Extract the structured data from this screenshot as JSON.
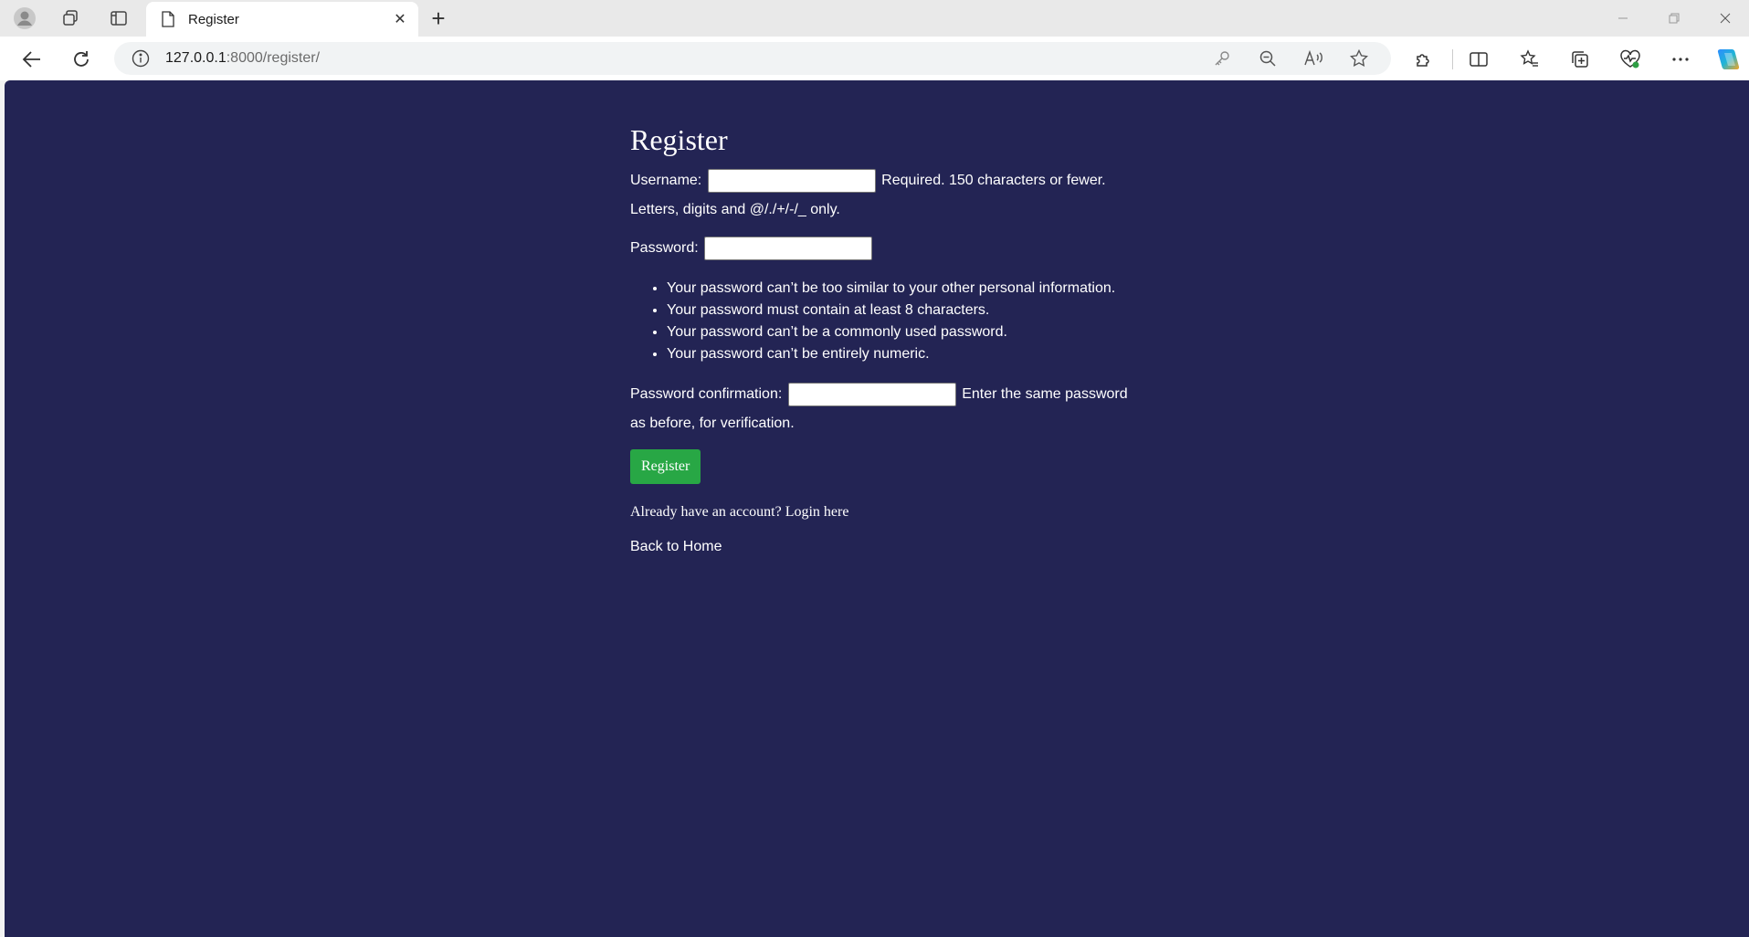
{
  "browser": {
    "tab": {
      "title": "Register",
      "close_glyph": "✕"
    },
    "new_tab_glyph": "+",
    "address": {
      "host": "127.0.0.1",
      "rest": ":8000/register/"
    },
    "icons": {
      "profile": "profile-icon",
      "workspaces": "workspaces-icon",
      "tab_actions": "tab-actions-icon",
      "back": "back-icon",
      "refresh": "refresh-icon",
      "info": "info-icon",
      "key": "key-icon",
      "zoom": "zoom-out-icon",
      "read_aloud": "read-aloud-icon",
      "favorite": "star-icon",
      "extensions": "extensions-icon",
      "split": "split-screen-icon",
      "favorites": "favorites-icon",
      "collections": "collections-icon",
      "health": "browser-essentials-icon",
      "more": "more-icon",
      "copilot": "copilot-icon"
    }
  },
  "page": {
    "title": "Register",
    "username": {
      "label": "Username:",
      "help_1": "Required. 150 characters or fewer.",
      "help_2": "Letters, digits and @/./+/-/_ only."
    },
    "password": {
      "label": "Password:"
    },
    "password_rules": [
      "Your password can’t be too similar to your other personal information.",
      "Your password must contain at least 8 characters.",
      "Your password can’t be a commonly used password.",
      "Your password can’t be entirely numeric."
    ],
    "password_confirmation": {
      "label": "Password confirmation:",
      "help_1": "Enter the same password",
      "help_2": "as before, for verification."
    },
    "submit_label": "Register",
    "login_prompt": "Already have an account?",
    "login_link": "Login here",
    "home_link": "Back to Home",
    "colors": {
      "background": "#232454",
      "button": "#28a745",
      "text": "#ffffff"
    }
  }
}
